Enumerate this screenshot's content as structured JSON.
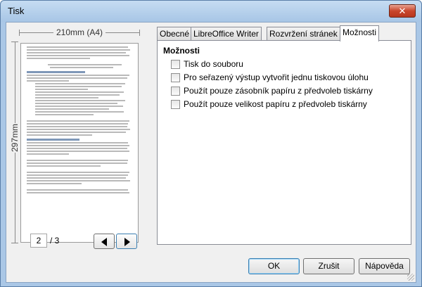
{
  "window": {
    "title": "Tisk",
    "close_glyph": "✕"
  },
  "preview": {
    "width_label": "210mm (A4)",
    "height_label": "297mm",
    "current_page": "2",
    "total_pages": "/ 3"
  },
  "tabs": [
    {
      "label": "Obecné"
    },
    {
      "label": "LibreOffice Writer"
    },
    {
      "label": "Rozvržení stránek"
    },
    {
      "label": "Možnosti"
    }
  ],
  "options": {
    "section_title": "Možnosti",
    "items": [
      {
        "label": "Tisk do souboru",
        "checked": false
      },
      {
        "label": "Pro seřazený výstup vytvořit jednu tiskovou úlohu",
        "checked": false
      },
      {
        "label": "Použít pouze zásobník papíru z předvoleb tiskárny",
        "checked": false
      },
      {
        "label": "Použít pouze velikost papíru z předvoleb tiskárny",
        "checked": false
      }
    ]
  },
  "buttons": {
    "ok": "OK",
    "cancel": "Zrušit",
    "help": "Nápověda"
  },
  "icons": {
    "close": "close-icon",
    "prev": "triangle-left-icon",
    "next": "triangle-right-icon"
  }
}
